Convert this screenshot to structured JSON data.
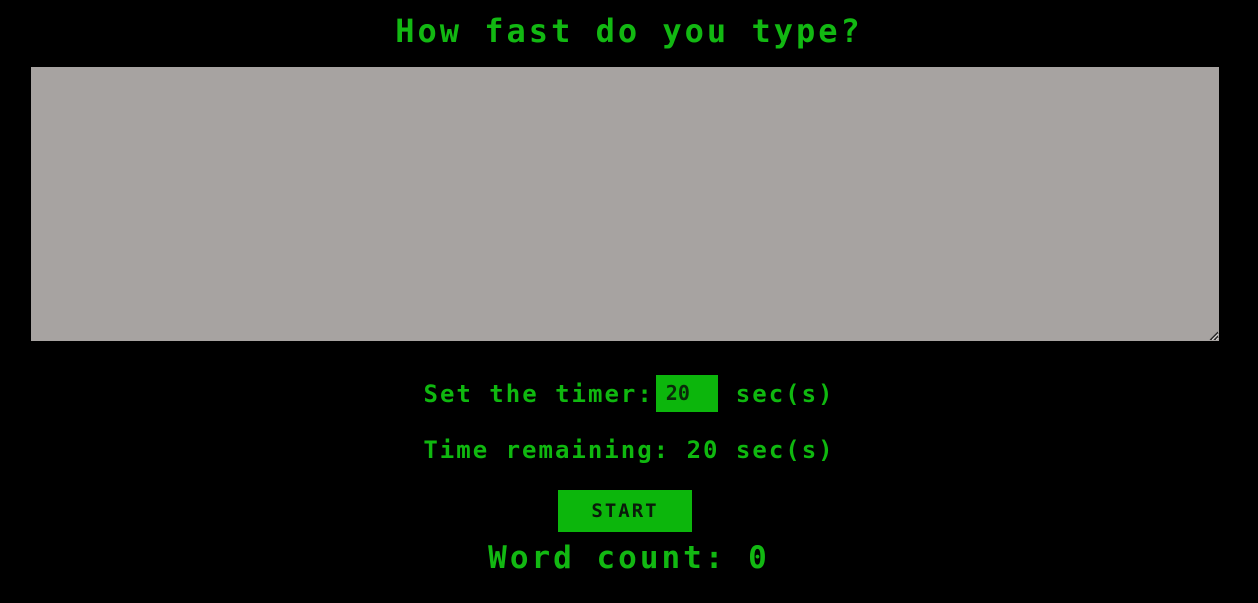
{
  "header": {
    "title": "How fast do you type?"
  },
  "typing_area": {
    "value": "",
    "placeholder": ""
  },
  "timer": {
    "label": "Set the timer:",
    "value": "20",
    "unit": "sec(s)"
  },
  "remaining": {
    "label": "Time remaining:",
    "value": "20",
    "unit": "sec(s)"
  },
  "controls": {
    "start_label": "START"
  },
  "results": {
    "word_count_label": "Word count:",
    "word_count_value": "0"
  },
  "colors": {
    "background": "#000000",
    "accent_green": "#0cb60c",
    "textarea_gray": "#a7a3a1"
  }
}
